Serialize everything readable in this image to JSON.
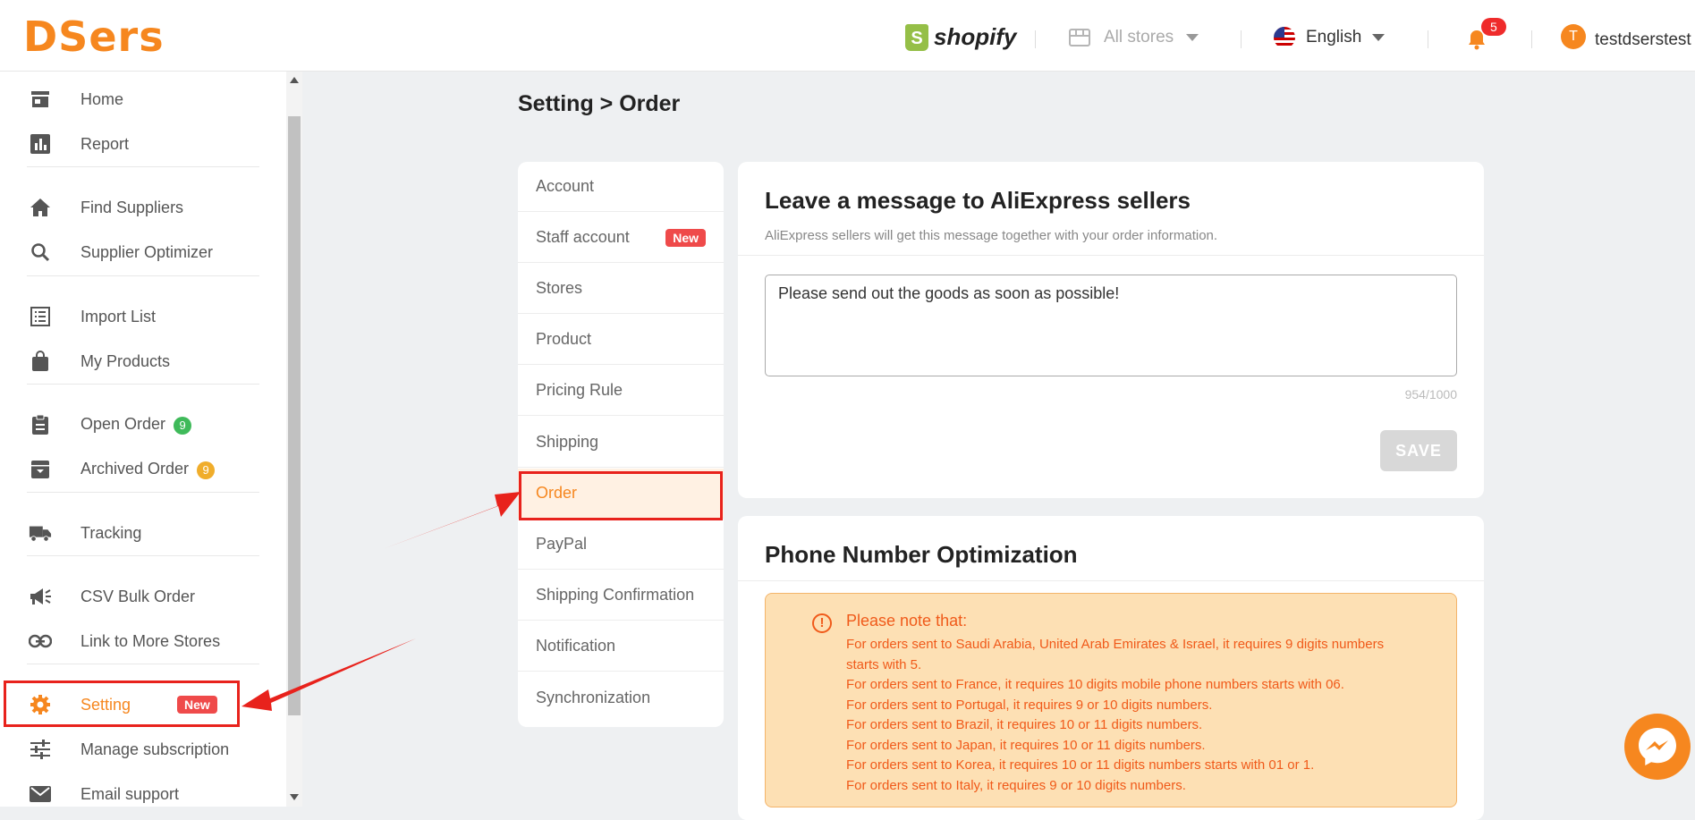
{
  "header": {
    "logo": "DSers",
    "shopify_label": "shopify",
    "store_selector": "All stores",
    "language": "English",
    "notification_count": "5",
    "avatar_initial": "T",
    "username": "testdserstest"
  },
  "sidebar": {
    "items": [
      {
        "label": "Home",
        "icon": "store-icon"
      },
      {
        "label": "Report",
        "icon": "bar-chart-icon"
      },
      {
        "label": "Find Suppliers",
        "icon": "home-icon"
      },
      {
        "label": "Supplier Optimizer",
        "icon": "search-icon"
      },
      {
        "label": "Import List",
        "icon": "list-icon"
      },
      {
        "label": "My Products",
        "icon": "bag-icon"
      },
      {
        "label": "Open Order",
        "icon": "clipboard-icon",
        "badge": "9",
        "badge_color": "#3fba5a"
      },
      {
        "label": "Archived Order",
        "icon": "archive-icon",
        "badge": "9",
        "badge_color": "#f0ad2b"
      },
      {
        "label": "Tracking",
        "icon": "truck-icon"
      },
      {
        "label": "CSV Bulk Order",
        "icon": "megaphone-icon"
      },
      {
        "label": "Link to More Stores",
        "icon": "link-icon"
      },
      {
        "label": "Setting",
        "icon": "gear-icon",
        "badge": "New",
        "active": true
      },
      {
        "label": "Manage subscription",
        "icon": "sliders-icon"
      },
      {
        "label": "Email support",
        "icon": "mail-icon"
      }
    ]
  },
  "page": {
    "breadcrumb": "Setting > Order"
  },
  "settings_menu": {
    "items": [
      "Account",
      "Staff account",
      "Stores",
      "Product",
      "Pricing Rule",
      "Shipping",
      "Order",
      "PayPal",
      "Shipping Confirmation",
      "Notification",
      "Synchronization"
    ],
    "new_badge": "New",
    "active": "Order"
  },
  "message_card": {
    "title": "Leave a message to AliExpress sellers",
    "subtitle": "AliExpress sellers will get this message together with your order information.",
    "message": "Please send out the goods as soon as possible!",
    "char_count": "954/1000",
    "save_label": "SAVE"
  },
  "phone_card": {
    "title": "Phone Number Optimization",
    "note_title": "Please note that:",
    "notes": [
      "For orders sent to Saudi Arabia, United Arab Emirates & Israel, it requires 9 digits numbers starts with 5.",
      "For orders sent to France, it requires 10 digits mobile phone numbers starts with 06.",
      "For orders sent to Portugal, it requires 9 or 10 digits numbers.",
      "For orders sent to Brazil, it requires 10 or 11 digits numbers.",
      "For orders sent to Japan, it requires 10 or 11 digits numbers.",
      "For orders sent to Korea, it requires 10 or 11 digits numbers starts with 01 or 1.",
      "For orders sent to Italy, it requires 9 or 10 digits numbers."
    ]
  },
  "colors": {
    "brand": "#f6871f",
    "highlight": "#e8221c",
    "active_bg": "#fff1e3",
    "note_bg": "#fde0b4",
    "note_text": "#f05a1a"
  }
}
